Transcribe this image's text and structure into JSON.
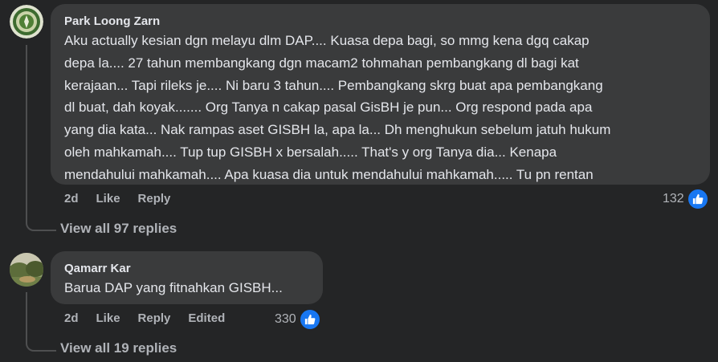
{
  "comments": [
    {
      "author": "Park Loong Zarn",
      "text": "Aku actually kesian dgn melayu dlm DAP.... Kuasa depa bagi, so mmg kena dgq cakap\ndepa la.... 27 tahun membangkang dgn macam2 tohmahan pembangkang dl bagi kat\nkerajaan... Tapi rileks je.... Ni baru 3 tahun.... Pembangkang skrg buat apa pembangkang\ndl buat, dah koyak....... Org Tanya n cakap pasal GisBH je pun... Org respond pada apa\nyang dia kata... Nak rampas aset GISBH la, apa la... Dh menghukun sebelum jatuh hukum\noleh mahkamah.... Tup tup GISBH x bersalah..... That's y org Tanya dia... Kenapa\nmendahului mahkamah.... Apa kuasa dia untuk mendahului mahkamah..... Tu pn rentan",
      "time": "2d",
      "like_label": "Like",
      "reply_label": "Reply",
      "reaction_count": "132",
      "view_replies": "View all 97 replies",
      "avatar_icon": "organization-logo-icon"
    },
    {
      "author": "Qamarr Kar",
      "text": "Barua DAP yang fitnahkan GISBH...",
      "time": "2d",
      "like_label": "Like",
      "reply_label": "Reply",
      "edited_label": "Edited",
      "reaction_count": "330",
      "view_replies": "View all 19 replies",
      "avatar_icon": "landscape-photo-icon"
    }
  ],
  "colors": {
    "background": "#242526",
    "bubble": "#3a3b3c",
    "primary_text": "#e4e6eb",
    "secondary_text": "#b0b3b8",
    "like_blue": "#1877f2"
  }
}
